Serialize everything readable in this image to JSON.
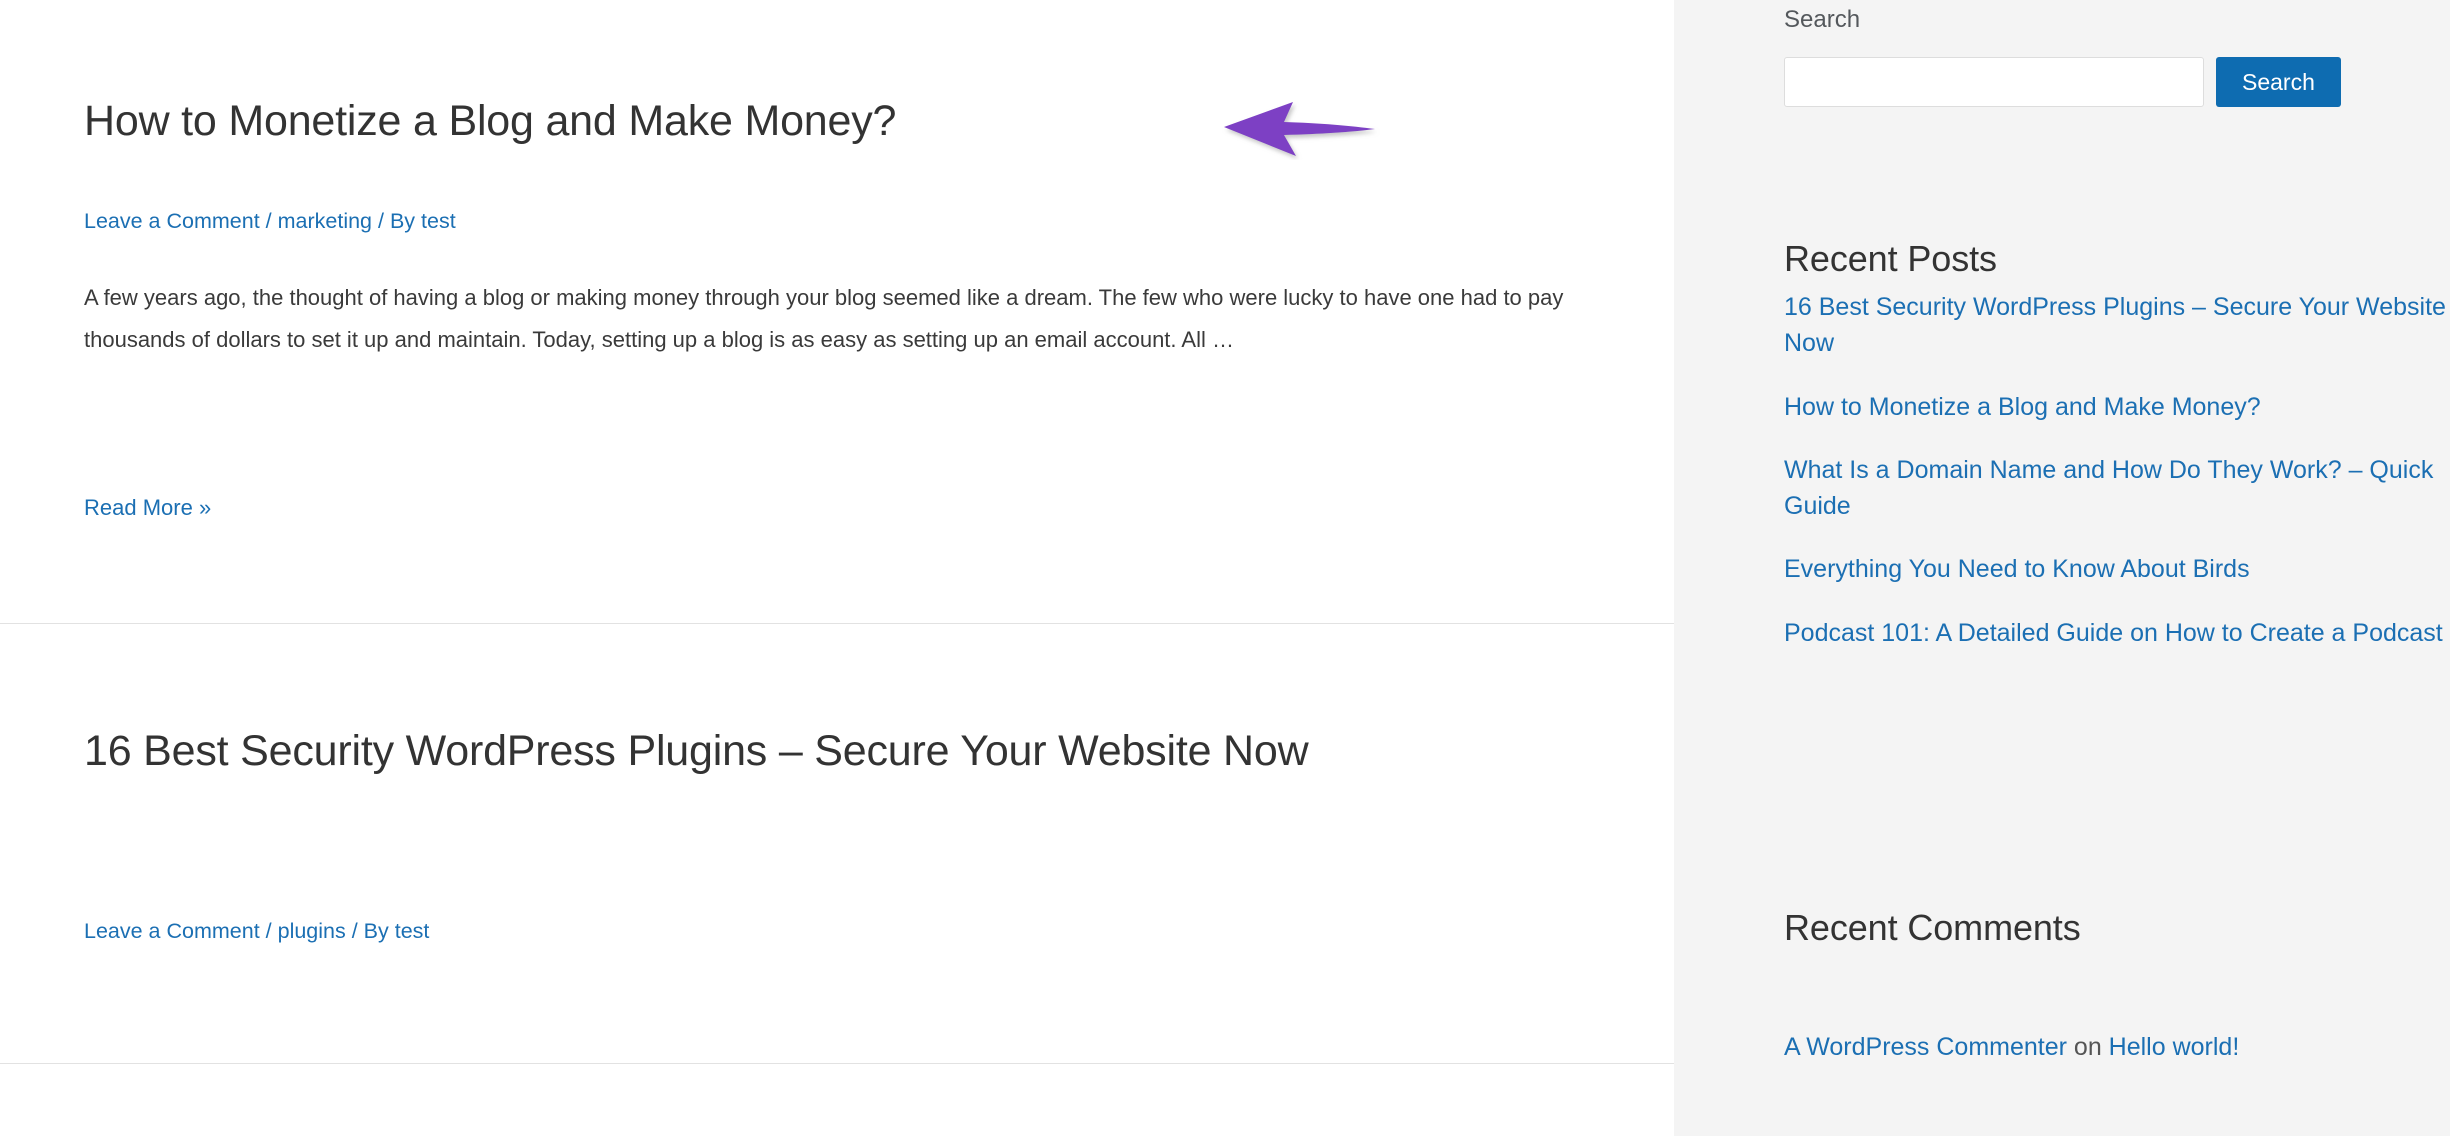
{
  "main": {
    "articles": [
      {
        "title": "How to Monetize a Blog and Make Money?",
        "meta": {
          "comment_link": "Leave a Comment",
          "sep1": " / ",
          "category": "marketing",
          "sep2": " / ",
          "by_prefix": "By ",
          "author": "test"
        },
        "excerpt": "A few years ago, the thought of having a blog or making money through your blog seemed like a dream. The few who were lucky to have one had to pay thousands of dollars to set it up and maintain. Today, setting up a blog is as easy as setting up an email account. All …",
        "read_more": "Read More »"
      },
      {
        "title": "16 Best Security WordPress Plugins – Secure Your Website Now",
        "meta": {
          "comment_link": "Leave a Comment",
          "sep1": " / ",
          "category": "plugins",
          "sep2": " / ",
          "by_prefix": "By ",
          "author": "test"
        }
      }
    ]
  },
  "annotation": {
    "type": "arrow",
    "direction": "left",
    "color": "#7d3fc4",
    "points_at": "How to Monetize a Blog and Make Money?"
  },
  "sidebar": {
    "search": {
      "label": "Search",
      "input_value": "",
      "input_placeholder": "",
      "button_label": "Search"
    },
    "recent_posts": {
      "title": "Recent Posts",
      "items": [
        "16 Best Security WordPress Plugins – Secure Your Website Now",
        "How to Monetize a Blog and Make Money?",
        "What Is a Domain Name and How Do They Work? – Quick Guide",
        "Everything You Need to Know About Birds",
        "Podcast 101: A Detailed Guide on How to Create a Podcast"
      ]
    },
    "recent_comments": {
      "title": "Recent Comments",
      "items": [
        {
          "author": "A WordPress Commenter",
          "connector": " on ",
          "post": "Hello world!"
        }
      ]
    }
  },
  "colors": {
    "link": "#1b6fb3",
    "heading": "#333333",
    "body_text": "#3a3a3a",
    "sidebar_bg": "#f4f4f4",
    "button_bg": "#0e6cb1",
    "arrow": "#7d3fc4",
    "divider": "#e2e2e2"
  }
}
